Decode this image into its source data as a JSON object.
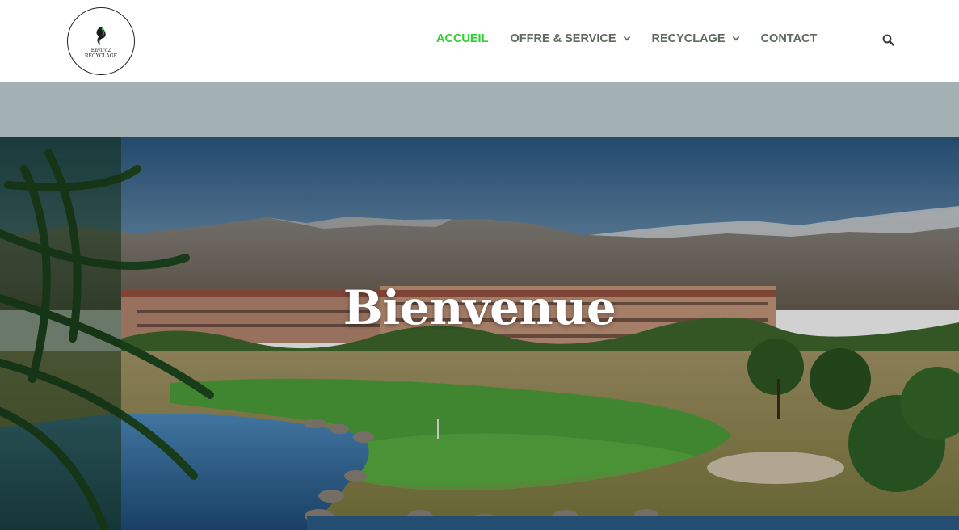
{
  "header": {
    "logo": {
      "line1": "Enviro2",
      "line2": "RECYCLAGE",
      "icon": "recycle-leaf-icon"
    },
    "nav": [
      {
        "label": "ACCUEIL",
        "active": true,
        "has_dropdown": false
      },
      {
        "label": "OFFRE & SERVICE",
        "active": false,
        "has_dropdown": true
      },
      {
        "label": "RECYCLAGE",
        "active": false,
        "has_dropdown": true
      },
      {
        "label": "CONTACT",
        "active": false,
        "has_dropdown": false
      }
    ],
    "search_icon": "search-icon"
  },
  "hero": {
    "title": "Bienvenue"
  },
  "colors": {
    "nav_active": "#2fcf2f",
    "nav_default": "#5e6b5e",
    "band": "#a3b1b5",
    "hero_title": "#ffffff"
  }
}
